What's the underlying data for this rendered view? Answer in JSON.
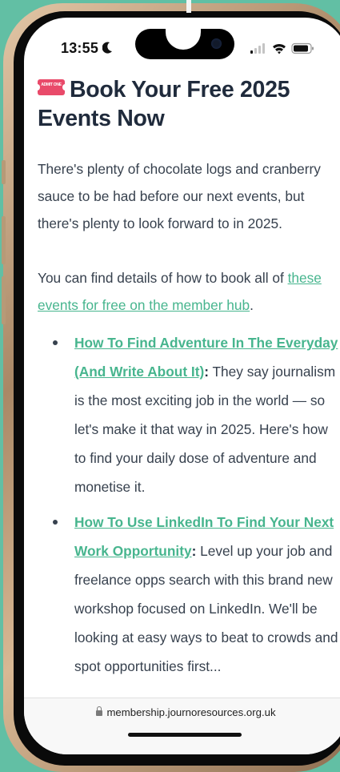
{
  "status": {
    "time": "13:55"
  },
  "article": {
    "title": "Book Your Free 2025 Events Now",
    "ticket_emoji_text": "ADMIT ONE",
    "intro": "There's plenty of chocolate logs and cranberry sauce to be had before our next events, but there's plenty to look forward to in 2025.",
    "find_details_prefix": "You can find details of how to book all of ",
    "member_hub_link": "these events for free on the member hub",
    "find_details_suffix": ".",
    "events": [
      {
        "title": "How To Find Adventure In The Everyday (And Write About It)",
        "colon": ":",
        "description": " They say journalism is the most exciting job in the world — so let's make it that way in 2025. Here's how to find your daily dose of adventure and monetise it."
      },
      {
        "title": "How To Use LinkedIn To Find Your Next Work Opportunity",
        "colon": ":",
        "description": " Level up your job and freelance opps search with this brand new workshop focused on LinkedIn. We'll be looking at easy ways to beat to crowds and spot opportunities first..."
      }
    ]
  },
  "browser": {
    "url": "membership.journoresources.org.uk"
  },
  "colors": {
    "background": "#62bfa4",
    "link": "#47b58e",
    "heading": "#202b3c",
    "body_text": "#37414e",
    "ticket": "#e94a6a"
  }
}
